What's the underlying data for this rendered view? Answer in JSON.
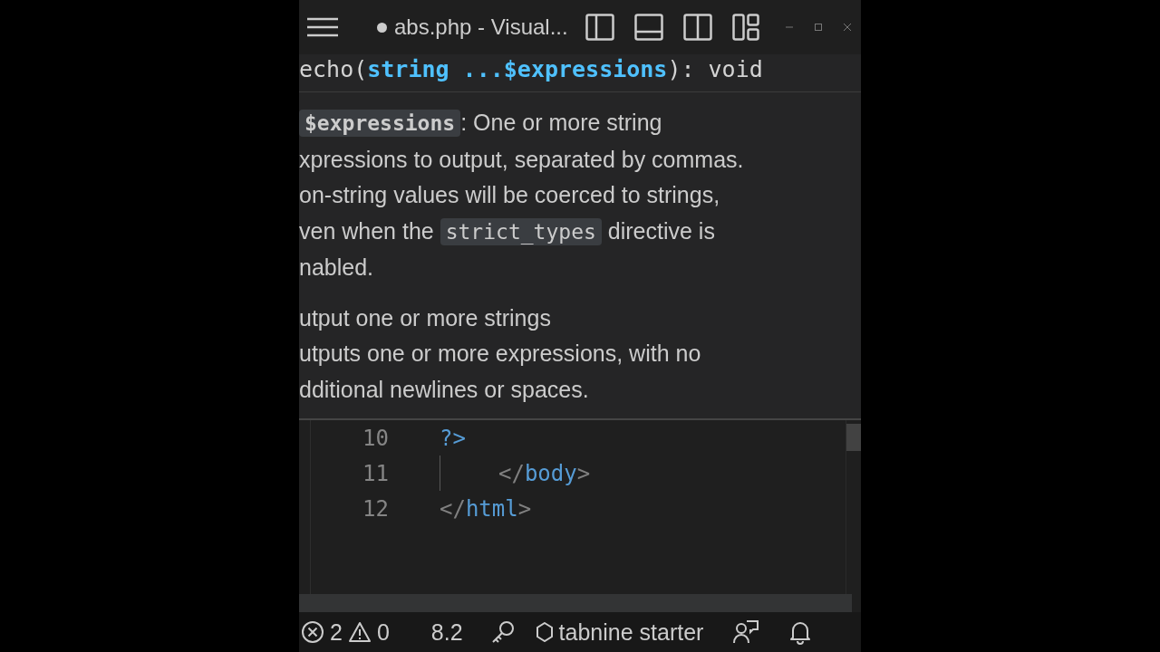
{
  "title_bar": {
    "modified": true,
    "title": "abs.php - Visual..."
  },
  "hover": {
    "signature": [
      {
        "kind": "plain",
        "text": "echo("
      },
      {
        "kind": "param",
        "text": "string ...$expressions"
      },
      {
        "kind": "plain",
        "text": "): void"
      }
    ],
    "description": [
      [
        {
          "kind": "code",
          "text": "$expressions"
        },
        {
          "kind": "text",
          "text": ": One or more string"
        }
      ],
      [
        {
          "kind": "text",
          "text": "xpressions to output, separated by commas."
        }
      ],
      [
        {
          "kind": "text",
          "text": "on-string values will be coerced to strings,"
        }
      ],
      [
        {
          "kind": "text",
          "text": "ven when the "
        },
        {
          "kind": "code",
          "text": "strict_types"
        },
        {
          "kind": "text",
          "text": " directive is"
        }
      ],
      [
        {
          "kind": "text",
          "text": "nabled."
        }
      ]
    ],
    "summary": [
      "utput one or more strings",
      "utputs one or more expressions, with no",
      "dditional newlines or spaces."
    ]
  },
  "editor": {
    "lines": [
      {
        "number": "10",
        "kind": "plain",
        "tokens": [
          {
            "kind": "php",
            "text": "?>"
          }
        ]
      },
      {
        "number": "11",
        "kind": "indented",
        "tokens": [
          {
            "kind": "punct",
            "text": "</"
          },
          {
            "kind": "tag",
            "text": "body"
          },
          {
            "kind": "punct",
            "text": ">"
          }
        ]
      },
      {
        "number": "12",
        "kind": "plain",
        "tokens": [
          {
            "kind": "punct",
            "text": "</"
          },
          {
            "kind": "tag",
            "text": "html"
          },
          {
            "kind": "punct",
            "text": ">"
          }
        ]
      }
    ]
  },
  "status_bar": {
    "errors": "2",
    "warnings": "0",
    "php_version": "8.2",
    "tabnine": "tabnine starter"
  }
}
